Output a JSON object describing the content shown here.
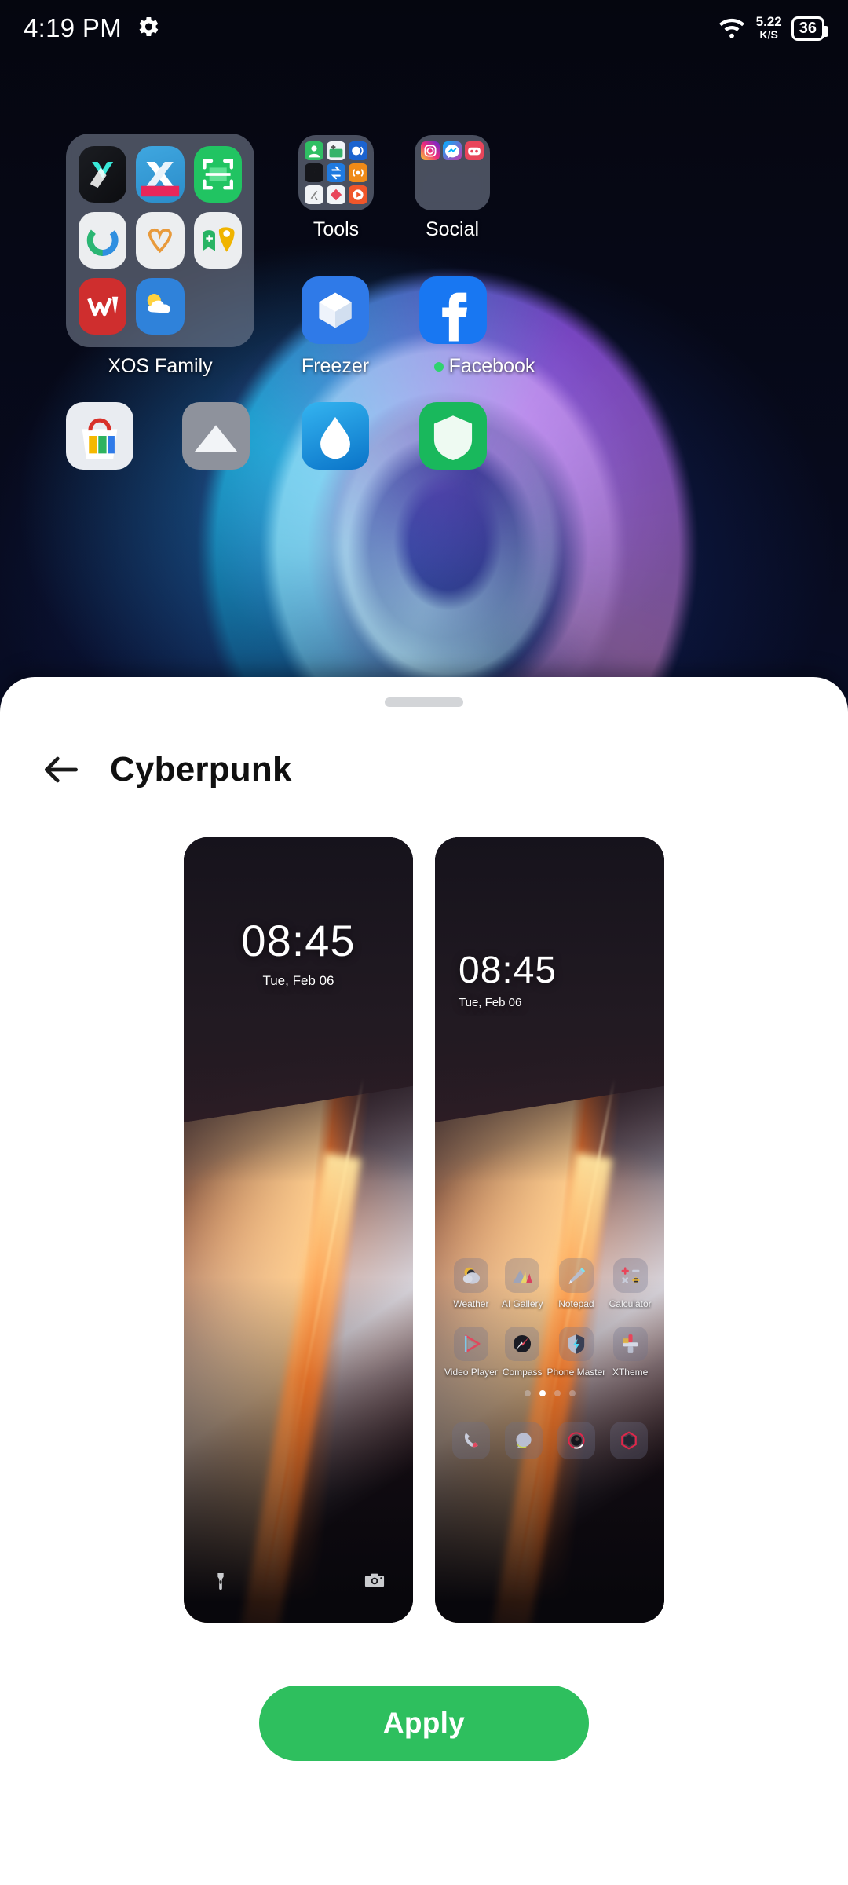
{
  "status_bar": {
    "time": "4:19 PM",
    "settings_icon": "gear-icon",
    "wifi_icon": "wifi-icon",
    "net_speed_value": "5.22",
    "net_speed_unit": "K/S",
    "battery_level": "36"
  },
  "home_screen": {
    "folders": [
      {
        "name": "XOS Family",
        "label": "XOS Family"
      },
      {
        "name": "Tools",
        "label": "Tools"
      },
      {
        "name": "Social",
        "label": "Social"
      }
    ],
    "apps": [
      {
        "name": "Freezer",
        "label": "Freezer"
      },
      {
        "name": "Facebook",
        "label": "Facebook",
        "has_badge": true
      }
    ]
  },
  "sheet": {
    "grabber": "drag-handle",
    "back_icon": "back-arrow-icon",
    "title": "Cyberpunk",
    "apply_label": "Apply",
    "accent_color": "#2ebf5e"
  },
  "previews": [
    {
      "name": "lock-screen-preview",
      "type": "lock",
      "clock_time": "08:45",
      "clock_date": "Tue, Feb 06",
      "left_action_icon": "flashlight-icon",
      "right_action_icon": "camera-icon"
    },
    {
      "name": "home-screen-preview",
      "type": "home",
      "clock_time": "08:45",
      "clock_date": "Tue, Feb 06",
      "apps": [
        {
          "label": "Weather",
          "icon": "weather-icon"
        },
        {
          "label": "AI Gallery",
          "icon": "gallery-icon"
        },
        {
          "label": "Notepad",
          "icon": "notepad-icon"
        },
        {
          "label": "Calculator",
          "icon": "calculator-icon"
        },
        {
          "label": "Video Player",
          "icon": "video-player-icon"
        },
        {
          "label": "Compass",
          "icon": "compass-icon"
        },
        {
          "label": "Phone Master",
          "icon": "shield-icon"
        },
        {
          "label": "XTheme",
          "icon": "theme-brush-icon"
        }
      ],
      "page_dots": {
        "count": 4,
        "active_index": 1
      },
      "dock": [
        {
          "icon": "phone-icon"
        },
        {
          "icon": "messages-icon"
        },
        {
          "icon": "camera-dock-icon"
        },
        {
          "icon": "browser-icon"
        }
      ]
    }
  ]
}
